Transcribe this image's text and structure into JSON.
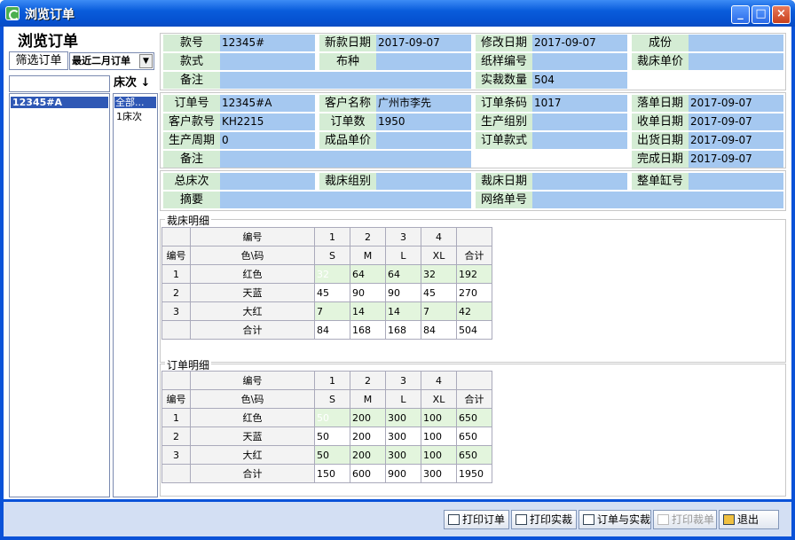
{
  "window": {
    "title": "浏览订单"
  },
  "heading": "浏览订单",
  "filter": {
    "label": "筛选订单",
    "selected": "最近二月订单"
  },
  "bed_header": "床次",
  "order_list": [
    "12345#A"
  ],
  "bed_list": [
    "全部...",
    "1床次"
  ],
  "style_info": [
    {
      "label": "款号",
      "value": "12345#"
    },
    {
      "label": "新款日期",
      "value": "2017-09-07"
    },
    {
      "label": "修改日期",
      "value": "2017-09-07"
    },
    {
      "label": "成份",
      "value": ""
    },
    {
      "label": "款式",
      "value": ""
    },
    {
      "label": "布种",
      "value": ""
    },
    {
      "label": "纸样编号",
      "value": ""
    },
    {
      "label": "裁床单价",
      "value": ""
    },
    {
      "label": "备注",
      "value": ""
    },
    {
      "label": "实裁数量",
      "value": "504"
    }
  ],
  "order_info": [
    {
      "label": "订单号",
      "value": "12345#A"
    },
    {
      "label": "客户名称",
      "value": "广州市李先"
    },
    {
      "label": "订单条码",
      "value": "1017"
    },
    {
      "label": "落单日期",
      "value": "2017-09-07"
    },
    {
      "label": "客户款号",
      "value": "KH2215"
    },
    {
      "label": "订单数",
      "value": "1950"
    },
    {
      "label": "生产组别",
      "value": ""
    },
    {
      "label": "收单日期",
      "value": "2017-09-07"
    },
    {
      "label": "生产周期",
      "value": "0"
    },
    {
      "label": "成品单价",
      "value": ""
    },
    {
      "label": "订单款式",
      "value": ""
    },
    {
      "label": "出货日期",
      "value": "2017-09-07"
    },
    {
      "label": "备注",
      "value": ""
    },
    {
      "label": "完成日期",
      "value": "2017-09-07"
    }
  ],
  "cut_info": [
    {
      "label": "总床次",
      "value": ""
    },
    {
      "label": "裁床组别",
      "value": ""
    },
    {
      "label": "裁床日期",
      "value": ""
    },
    {
      "label": "整单缸号",
      "value": ""
    },
    {
      "label": "摘要",
      "value": ""
    },
    {
      "label": "网络单号",
      "value": ""
    }
  ],
  "cut_detail": {
    "title": "裁床明细",
    "h_code": "编号",
    "h_color": "色\\码",
    "h_num": "编号",
    "size_nums": [
      "1",
      "2",
      "3",
      "4"
    ],
    "sizes": [
      "S",
      "M",
      "L",
      "XL"
    ],
    "total_label": "合计",
    "rows": [
      {
        "no": "1",
        "color": "红色",
        "values": [
          "32",
          "64",
          "64",
          "32",
          "192"
        ]
      },
      {
        "no": "2",
        "color": "天蓝",
        "values": [
          "45",
          "90",
          "90",
          "45",
          "270"
        ]
      },
      {
        "no": "3",
        "color": "大红",
        "values": [
          "7",
          "14",
          "14",
          "7",
          "42"
        ]
      }
    ],
    "total_row": {
      "label": "合计",
      "values": [
        "84",
        "168",
        "168",
        "84",
        "504"
      ]
    }
  },
  "order_detail": {
    "title": "订单明细",
    "h_code": "编号",
    "h_color": "色\\码",
    "h_num": "编号",
    "size_nums": [
      "1",
      "2",
      "3",
      "4"
    ],
    "sizes": [
      "S",
      "M",
      "L",
      "XL"
    ],
    "total_label": "合计",
    "rows": [
      {
        "no": "1",
        "color": "红色",
        "values": [
          "50",
          "200",
          "300",
          "100",
          "650"
        ]
      },
      {
        "no": "2",
        "color": "天蓝",
        "values": [
          "50",
          "200",
          "300",
          "100",
          "650"
        ]
      },
      {
        "no": "3",
        "color": "大红",
        "values": [
          "50",
          "200",
          "300",
          "100",
          "650"
        ]
      }
    ],
    "total_row": {
      "label": "合计",
      "values": [
        "150",
        "600",
        "900",
        "300",
        "1950"
      ]
    }
  },
  "buttons": {
    "print_order": "打印订单",
    "print_cut": "打印实裁",
    "order_and_cut": "订单与实裁",
    "print_cut_sheet": "打印裁单",
    "exit": "退出"
  }
}
